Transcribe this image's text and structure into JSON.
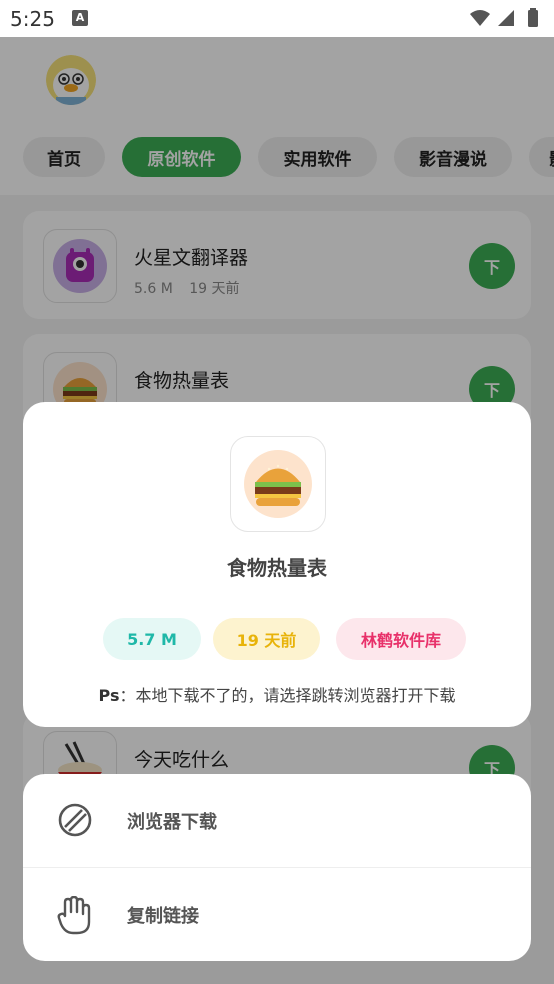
{
  "status_bar": {
    "time": "5:25",
    "badge": "A"
  },
  "tabs": [
    {
      "label": "首页"
    },
    {
      "label": "原创软件"
    },
    {
      "label": "实用软件"
    },
    {
      "label": "影音漫说"
    },
    {
      "label": "影"
    }
  ],
  "apps": [
    {
      "name": "火星文翻译器",
      "size": "5.6 M",
      "date": "19 天前",
      "download_label": "下"
    },
    {
      "name": "食物热量表",
      "size": "",
      "date": "",
      "download_label": "下"
    },
    {
      "name": "今天吃什么",
      "size": "",
      "date": "",
      "download_label": "下"
    }
  ],
  "dialog": {
    "title": "食物热量表",
    "size": "5.7 M",
    "date": "19 天前",
    "source": "林鹤软件库",
    "note_prefix": "Ps",
    "note_text": "：本地下载不了的，请选择跳转浏览器打开下载"
  },
  "sheet": {
    "browser_download": "浏览器下载",
    "copy_link": "复制链接"
  },
  "colors": {
    "accent": "#3cae55",
    "size_pill": "#1fb8a8",
    "date_pill": "#e8b30a",
    "source_pill": "#e8316a"
  }
}
